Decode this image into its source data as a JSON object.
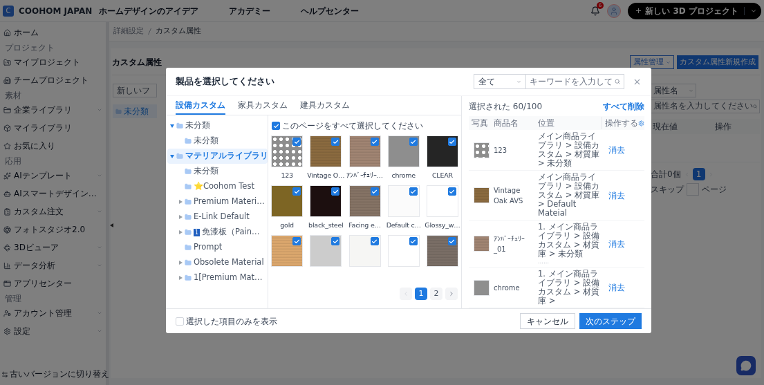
{
  "header": {
    "logo_letter": "C",
    "brand": "COOHOM JAPAN",
    "nav": [
      "ホームデザインのアイデア",
      "アカデミー",
      "ヘルプセンター"
    ],
    "notification_count": "6",
    "new_project_button": "新しい 3D プロジェクト"
  },
  "sidebar": {
    "sections": [
      {
        "items": [
          {
            "label": "ホーム",
            "has_submenu": false
          }
        ]
      },
      {
        "heading": "プロジェクト",
        "items": [
          {
            "label": "マイプロジェクト",
            "has_submenu": false
          },
          {
            "label": "チームプロジェクト",
            "has_submenu": false
          }
        ]
      },
      {
        "heading": "素材",
        "items": [
          {
            "label": "企業ライブラリ",
            "has_submenu": true
          },
          {
            "label": "マイライブラリ",
            "has_submenu": false
          },
          {
            "label": "お気に入り",
            "has_submenu": false
          }
        ]
      },
      {
        "heading": "応用",
        "items": [
          {
            "label": "AIテンプレート",
            "has_submenu": true
          },
          {
            "label": "AIスマートデザイン…",
            "has_submenu": false
          },
          {
            "label": "カスタム注文",
            "has_submenu": true
          },
          {
            "label": "フォトスタジオ2.0",
            "has_submenu": false
          },
          {
            "label": "3Dビューア",
            "has_submenu": true
          },
          {
            "label": "データ分析",
            "has_submenu": true
          },
          {
            "label": "アプリセンター",
            "has_submenu": false
          }
        ]
      },
      {
        "heading": "管理",
        "items": [
          {
            "label": "アカウント管理",
            "has_submenu": true
          },
          {
            "label": "設定",
            "has_submenu": true
          }
        ]
      }
    ],
    "switch_version": "古いバージョンに切り替え"
  },
  "page": {
    "breadcrumb": [
      "詳細設定",
      "カスタム属性"
    ],
    "title": "カスタム属性",
    "manage_button": "属性管理",
    "create_button": "カスタム属性新規作成",
    "new_folder_button": "新しいフ",
    "folders": [
      {
        "label": "未分類",
        "selected": true
      }
    ],
    "filter_select": "属性名",
    "search_placeholder": "属性名を入力してください",
    "columns": [
      "現在値",
      "操作"
    ],
    "total": "合計0個",
    "pages": [
      {
        "label": "1",
        "selected": true
      }
    ],
    "skip_label": "スキップ",
    "page_suffix": "ページ"
  },
  "modal": {
    "title": "製品を選択してください",
    "category_select": "全て",
    "search_placeholder": "キーワードを入力して",
    "tabs": [
      {
        "label": "設備カスタム",
        "selected": true
      },
      {
        "label": "家具カスタム",
        "selected": false
      },
      {
        "label": "建具カスタム",
        "selected": false
      }
    ],
    "tree": [
      {
        "label": "未分類",
        "expanded": true,
        "selected": false,
        "children": [
          {
            "label": "未分類",
            "selected": false
          }
        ]
      },
      {
        "label": "マテリアルライブラリ",
        "expanded": true,
        "selected": true,
        "children": [
          {
            "label": "未分類",
            "selected": false
          },
          {
            "label": "⭐Coohom Test",
            "selected": false
          },
          {
            "label": "Premium Materi…",
            "expanded": false,
            "selected": false
          },
          {
            "label": "E-Link Default",
            "expanded": false,
            "selected": false
          },
          {
            "label": "免漆板（Pain…",
            "badge": "1",
            "expanded": false,
            "selected": false
          },
          {
            "label": "Prompt",
            "selected": false
          },
          {
            "label": "Obsolete Material",
            "expanded": false,
            "selected": false
          },
          {
            "label": "1[Premium Mat…",
            "expanded": false,
            "selected": false
          }
        ]
      }
    ],
    "select_all": {
      "label": "このページをすべて選択してください",
      "checked": true
    },
    "products": [
      {
        "name": "123",
        "kind": "dots",
        "color": "#8d8d8d",
        "checked": true
      },
      {
        "name": "Vintage O…",
        "kind": "grain",
        "color": "#8a6a3f",
        "checked": true
      },
      {
        "name": "ｱﾝﾊﾞｰﾁｪﾘｰ…",
        "kind": "grain",
        "color": "#a08472",
        "checked": true
      },
      {
        "name": "chrome",
        "kind": "plain",
        "color": "#8e8e8e",
        "checked": true
      },
      {
        "name": "CLEAR",
        "kind": "plain",
        "color": "#252525",
        "checked": true
      },
      {
        "name": "gold",
        "kind": "plain",
        "color": "#7d6524",
        "checked": true
      },
      {
        "name": "black_steel",
        "kind": "plain",
        "color": "#1c0f0f",
        "checked": true
      },
      {
        "name": "Facing e…",
        "kind": "grain",
        "color": "#857365",
        "checked": true
      },
      {
        "name": "Default c…",
        "kind": "plain",
        "color": "#fbfbfb",
        "checked": true
      },
      {
        "name": "Glossy_w…",
        "kind": "plain",
        "color": "#ffffff",
        "checked": true
      },
      {
        "kind": "grain",
        "color": "#dba76d",
        "checked": true
      },
      {
        "kind": "plain",
        "color": "#cccccc",
        "checked": true
      },
      {
        "kind": "plain",
        "color": "#f6f6f4",
        "checked": true
      },
      {
        "kind": "plain",
        "color": "#ffffff",
        "checked": true
      },
      {
        "kind": "grain",
        "color": "#7a6e66",
        "checked": true
      }
    ],
    "pages": [
      {
        "label": "1",
        "selected": true
      },
      {
        "label": "2",
        "selected": false
      }
    ],
    "selected_count": "選択された 60/100",
    "clear_all": "すべて削除",
    "columns": [
      "写真",
      "商品名",
      "位置",
      "操作する"
    ],
    "rows": [
      {
        "kind": "dots",
        "color": "#8d8d8d",
        "name": "123",
        "location": "メイン商品ライブラリ > 設備カスタム > 材質庫 > 未分類",
        "action": "消去"
      },
      {
        "kind": "grain",
        "color": "#8a6a3f",
        "name": "Vintage Oak AVS",
        "location": "メイン商品ライブラリ > 設備カスタム > 材質庫 > Default Mateial",
        "action": "消去"
      },
      {
        "kind": "grain",
        "color": "#a08472",
        "name": "ｱﾝﾊﾞｰﾁｪﾘｰ_01",
        "location": "1. メイン商品ライブラリ > 設備カスタム > 材質庫 > 未分類",
        "note": "……",
        "action": "消去"
      },
      {
        "kind": "plain",
        "color": "#8e8e8e",
        "name": "chrome",
        "location": "1. メイン商品ライブラリ > 設備カスタム > 材質庫 >",
        "action": "消去"
      }
    ],
    "show_selected_only": {
      "label": "選択した項目のみを表示",
      "checked": false
    },
    "cancel_button": "キャンセル",
    "next_button": "次のステップ"
  }
}
